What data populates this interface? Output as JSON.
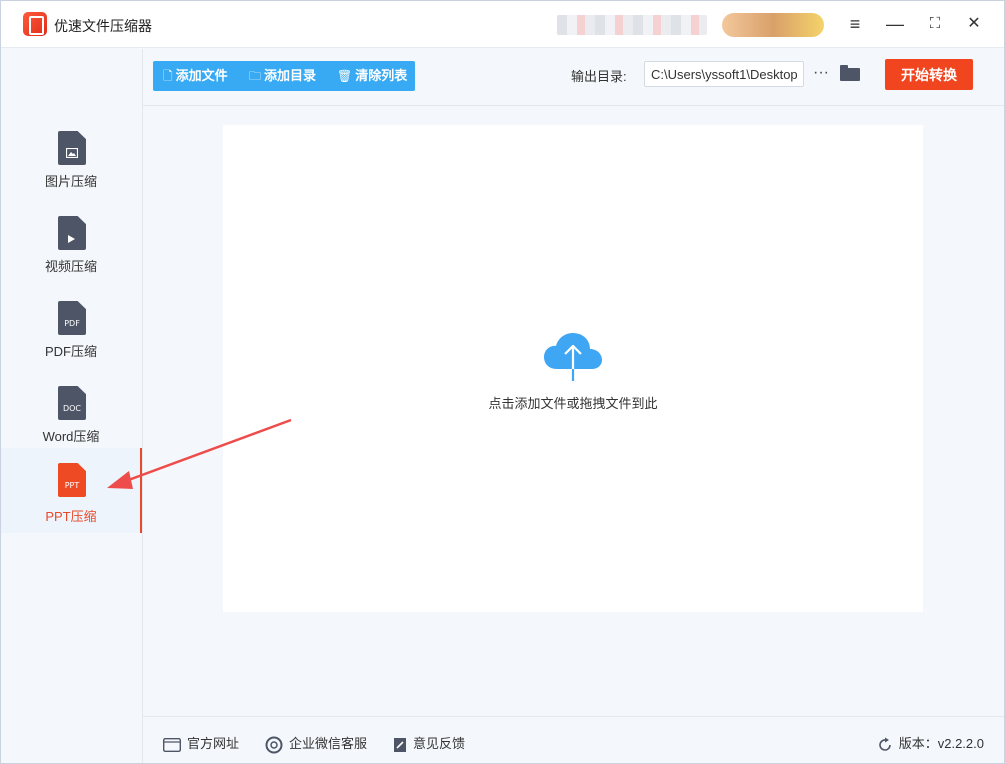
{
  "app": {
    "title": "优速文件压缩器"
  },
  "window_controls": {
    "menu": "≡",
    "minimize": "—",
    "maximize": "⛶",
    "close": "✕"
  },
  "sidebar": {
    "items": [
      {
        "label": "图片压缩",
        "icon": "image-file-icon",
        "tag": "",
        "active": false
      },
      {
        "label": "视频压缩",
        "icon": "video-file-icon",
        "tag": "",
        "active": false
      },
      {
        "label": "PDF压缩",
        "icon": "pdf-file-icon",
        "tag": "PDF",
        "active": false
      },
      {
        "label": "Word压缩",
        "icon": "doc-file-icon",
        "tag": "DOC",
        "active": false
      },
      {
        "label": "PPT压缩",
        "icon": "ppt-file-icon",
        "tag": "PPT",
        "active": true
      }
    ]
  },
  "toolbar": {
    "add_file": "添加文件",
    "add_folder": "添加目录",
    "clear_list": "清除列表",
    "output_label": "输出目录:",
    "output_path": "C:\\Users\\yssoft1\\Desktop",
    "more": "···",
    "start": "开始转换"
  },
  "drop_area": {
    "hint": "点击添加文件或拖拽文件到此"
  },
  "footer": {
    "website": "官方网址",
    "wechat": "企业微信客服",
    "feedback": "意见反馈",
    "version": "版本：v2.2.2.0"
  },
  "colors": {
    "accent_blue": "#38a9f3",
    "accent_red": "#f0451f",
    "icon_gray": "#4d5566"
  }
}
